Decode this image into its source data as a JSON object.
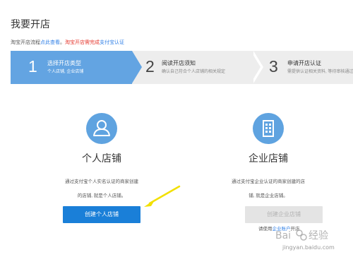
{
  "page": {
    "title": "我要开店"
  },
  "notice": {
    "prefix": "淘宝开店流程",
    "link": "点此查看",
    "sep": "。",
    "warn": "淘宝开店需完成",
    "link2": "支付宝认证"
  },
  "steps": [
    {
      "num": "1",
      "title": "选择开店类型",
      "desc": "个人店铺, 企业店铺"
    },
    {
      "num": "2",
      "title": "阅读开店须知",
      "desc": "确认自己符合个人店铺的相关规定"
    },
    {
      "num": "3",
      "title": "申请开店认证",
      "desc": "需提供认证相关资料, 等待审核通过"
    }
  ],
  "cards": {
    "personal": {
      "title": "个人店铺",
      "desc_line1": "通过支付宝个人实名认证的商家创建",
      "desc_line2": "的店铺, 就是个人店铺。",
      "button": "创建个人店铺",
      "icon": "person-icon"
    },
    "enterprise": {
      "title": "企业店铺",
      "desc_line1": "通过支付宝企业认证的商家创建的店",
      "desc_line2": "铺, 就是企业店铺。",
      "button": "创建企业店铺",
      "icon": "building-icon",
      "hint_prefix": "请使用",
      "hint_link": "企业账户",
      "hint_suffix": "开店"
    }
  },
  "annotation": {
    "arrow_color": "#f2e000"
  },
  "watermark": {
    "text": "jingyan.baidu.com"
  },
  "colors": {
    "accent": "#1a7fd8",
    "step_active": "#63a4e2",
    "warn": "#e5362c"
  }
}
